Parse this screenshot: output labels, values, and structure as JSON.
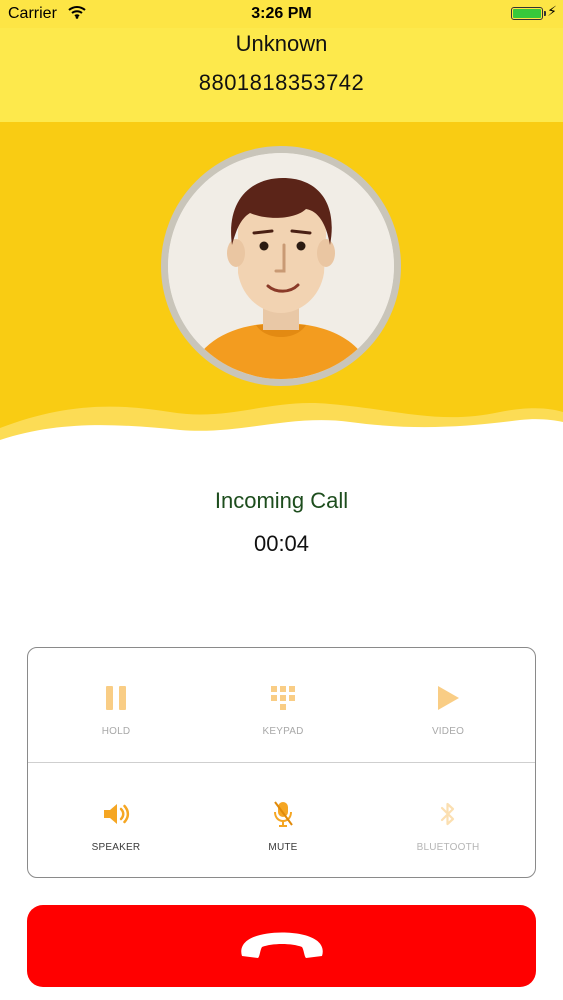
{
  "status_bar": {
    "carrier": "Carrier",
    "time": "3:26 PM",
    "battery_color": "#37c93b"
  },
  "caller": {
    "name": "Unknown",
    "number": "8801818353742"
  },
  "call": {
    "status": "Incoming Call",
    "duration": "00:04"
  },
  "controls": {
    "hold": {
      "label": "HOLD",
      "icon": "pause-icon"
    },
    "keypad": {
      "label": "KEYPAD",
      "icon": "keypad-icon"
    },
    "video": {
      "label": "VIDEO",
      "icon": "play-icon"
    },
    "speaker": {
      "label": "SPEAKER",
      "icon": "speaker-icon"
    },
    "mute": {
      "label": "MUTE",
      "icon": "mute-mic-icon"
    },
    "bluetooth": {
      "label": "BLUETOOTH",
      "icon": "bluetooth-icon"
    }
  },
  "end_call": {
    "icon": "hang-up-phone-icon",
    "color": "#ff0000"
  },
  "colors": {
    "header": "#fde94c",
    "hero": "#f9cc13",
    "accent": "#f5a623"
  }
}
